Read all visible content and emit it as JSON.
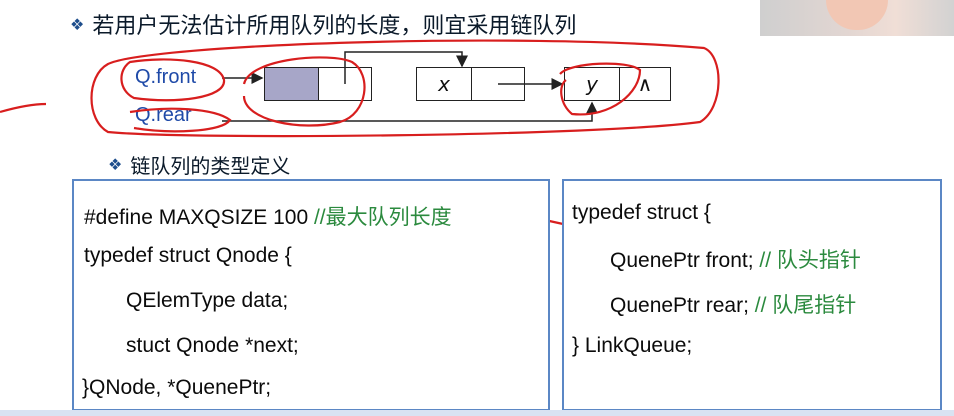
{
  "slide": {
    "title": "若用户无法估计所用队列的长度，则宜采用链队列",
    "subtitle": "链队列的类型定义",
    "bullet_icon": "diamond-bullet-icon"
  },
  "diagram": {
    "front_label": "Q.front",
    "rear_label": "Q.rear",
    "node2_data": "x",
    "node3_data": "y",
    "null_symbol": "∧"
  },
  "code_left": {
    "line1_code": "#define MAXQSIZE 100 ",
    "line1_comment": "//最大队列长度",
    "line2": "typedef struct  Qnode {",
    "line3": "QElemType    data;",
    "line4": "stuct  Qnode  *next;",
    "line5": "}QNode, *QuenePtr;"
  },
  "code_right": {
    "line1": "typedef struct {",
    "line2_code": "QuenePtr front; ",
    "line2_comment": "// 队头指针",
    "line3_code": "QuenePtr rear; ",
    "line3_comment": "// 队尾指针",
    "line4": "} LinkQueue;"
  },
  "colors": {
    "accent_blue": "#1f4aa8",
    "box_border": "#5b87c5",
    "comment_green": "#2b8a3e",
    "annotation_red": "#d81e1e",
    "node_shade": "#a7a6c8"
  }
}
